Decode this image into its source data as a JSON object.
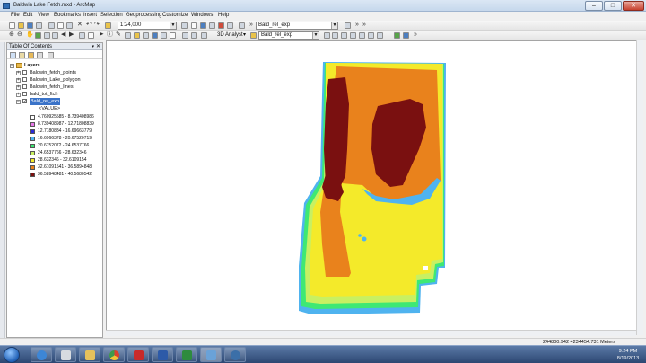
{
  "window": {
    "title": "Baldwin Lake Fetch.mxd - ArcMap",
    "minimize": "–",
    "maximize": "□",
    "close": "✕"
  },
  "menu": [
    "File",
    "Edit",
    "View",
    "Bookmarks",
    "Insert",
    "Selection",
    "Geoprocessing",
    "Customize",
    "Windows",
    "Help"
  ],
  "toolbar": {
    "scale_value": "1:24,000",
    "layer_combo": "Bald_rel_exp",
    "analyst_label": "3D Analyst",
    "analyst_layer": "Bald_rel_exp"
  },
  "toc": {
    "title": "Table Of Contents",
    "pin": "▾",
    "close": "✕",
    "root": "Layers",
    "layers": [
      {
        "name": "Baldwin_fetch_points",
        "checked": false
      },
      {
        "name": "Baldwin_Lake_polygon",
        "checked": false
      },
      {
        "name": "Baldwin_fetch_lines",
        "checked": false
      },
      {
        "name": "bald_tot_ftch",
        "checked": false
      },
      {
        "name": "Bald_rel_exp",
        "checked": true,
        "selected": true
      }
    ],
    "value_heading": "<VALUE>",
    "legend": [
      {
        "label": "4.760925585 - 8.739408986",
        "color": "#ffffff"
      },
      {
        "label": "8.739408987 - 12.71808839",
        "color": "#e879e8"
      },
      {
        "label": "12.7180884 - 16.69663779",
        "color": "#2b2bd8"
      },
      {
        "label": "16.6966378 - 20.67520719",
        "color": "#4fb3ef"
      },
      {
        "label": "20.6752072 - 24.6537766",
        "color": "#3ee874"
      },
      {
        "label": "24.6537766 - 28.632346",
        "color": "#c8f062"
      },
      {
        "label": "28.632346 - 32.6109154",
        "color": "#f4ea2a"
      },
      {
        "label": "32.61091541 - 36.5894848",
        "color": "#e9821c"
      },
      {
        "label": "36.58948481 - 40.5680542",
        "color": "#7a1010"
      }
    ]
  },
  "status": {
    "coordinates": "244800.942  4234454.731 Meters"
  },
  "clock": {
    "time": "9:24 PM",
    "date": "8/19/2013"
  },
  "icons": {
    "start": "windows-orb",
    "tasks": [
      "ie",
      "media",
      "chrome",
      "acrobat",
      "word",
      "excel",
      "arcmap",
      "arcgis"
    ]
  }
}
